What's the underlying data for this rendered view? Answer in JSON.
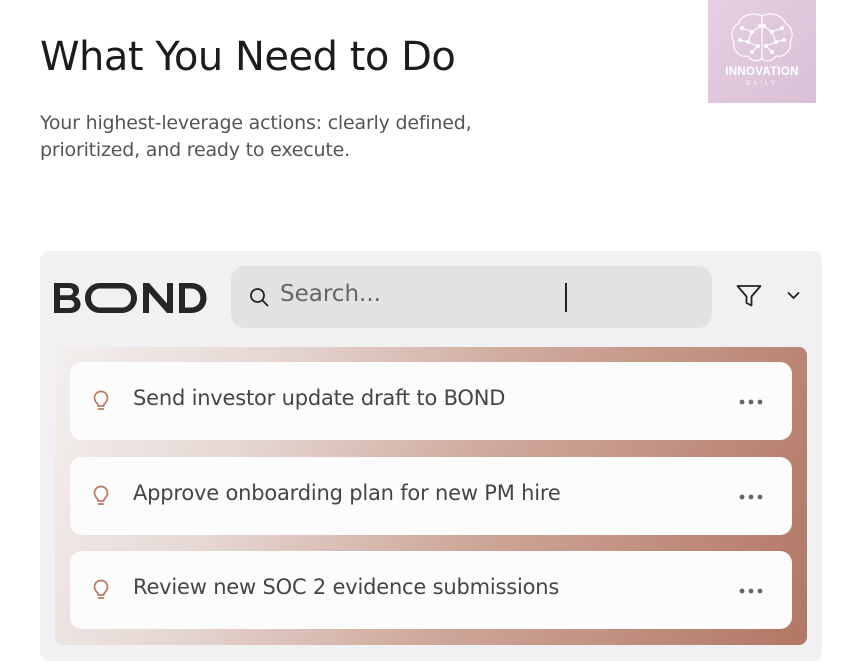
{
  "header": {
    "title": "What You Need to Do",
    "subtitle": "Your highest-leverage actions: clearly defined, prioritized, and ready to execute."
  },
  "badge": {
    "name": "INNOVATION",
    "sub": "DAILY",
    "icon": "brain-icon",
    "color": "#e2c9dd"
  },
  "app": {
    "logo": "BOND",
    "search": {
      "placeholder": "Search...",
      "icon": "search-icon"
    },
    "filter_icon": "filter-icon",
    "dropdown_icon": "chevron-down-icon",
    "tasks": [
      {
        "label": "Send investor update draft to BOND",
        "icon": "lightbulb-icon"
      },
      {
        "label": "Approve onboarding plan for new PM hire",
        "icon": "lightbulb-icon"
      },
      {
        "label": "Review new SOC 2 evidence submissions",
        "icon": "lightbulb-icon"
      }
    ],
    "accent": "#b9795f"
  }
}
